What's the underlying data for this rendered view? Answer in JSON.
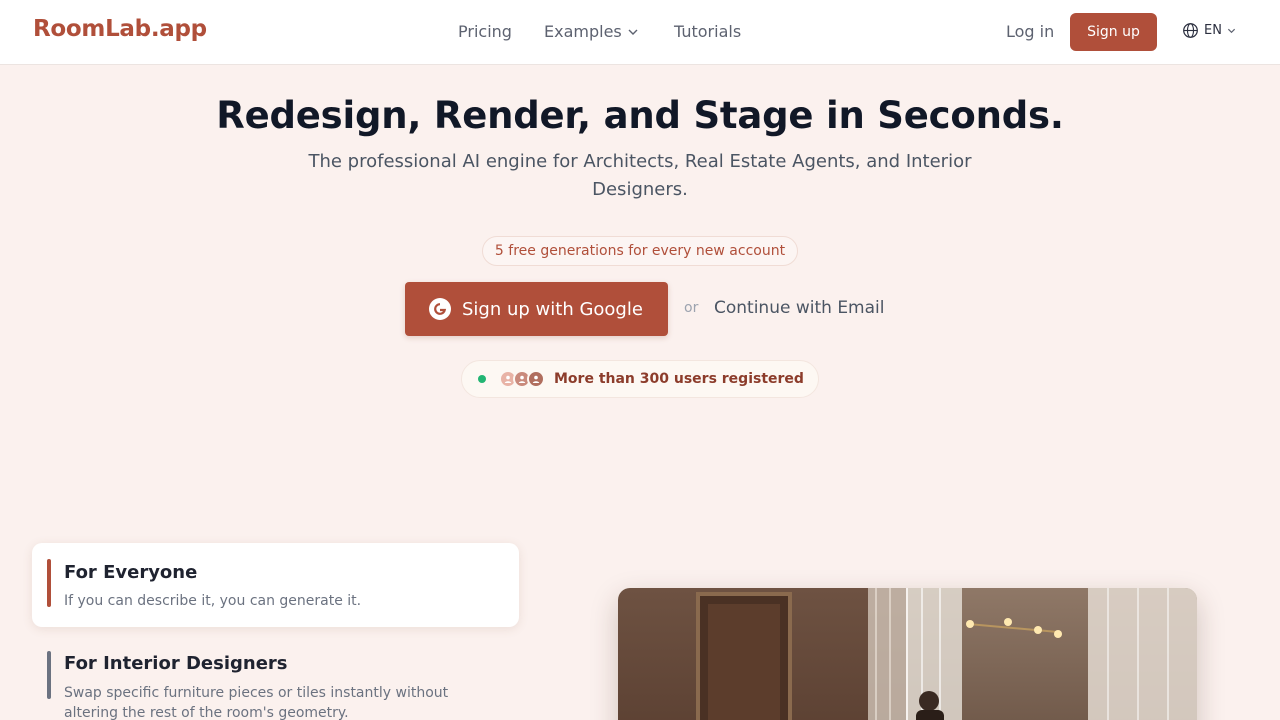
{
  "header": {
    "logo": "RoomLab.app",
    "nav": {
      "pricing": "Pricing",
      "examples": "Examples",
      "tutorials": "Tutorials"
    },
    "login": "Log in",
    "signup": "Sign up",
    "language": "EN"
  },
  "hero": {
    "title": "Redesign, Render, and Stage in Seconds.",
    "subtitle": "The professional AI engine for Architects, Real Estate Agents, and Interior Designers.",
    "free_badge": "5 free generations for every new account",
    "google_button": "Sign up with Google",
    "or": "or",
    "email_link": "Continue with Email",
    "users_text": "More than 300 users registered"
  },
  "features": [
    {
      "title": "For Everyone",
      "description": "If you can describe it, you can generate it."
    },
    {
      "title": "For Interior Designers",
      "description": "Swap specific furniture pieces or tiles instantly without altering the rest of the room's geometry."
    }
  ],
  "colors": {
    "brand": "#b04f3a",
    "background": "#fbf1ee",
    "online_dot": "#22b573"
  },
  "icons": {
    "examples_dropdown": "chevron-down-icon",
    "language": "globe-icon",
    "google": "google-icon",
    "avatars": "user-avatar-icon"
  }
}
